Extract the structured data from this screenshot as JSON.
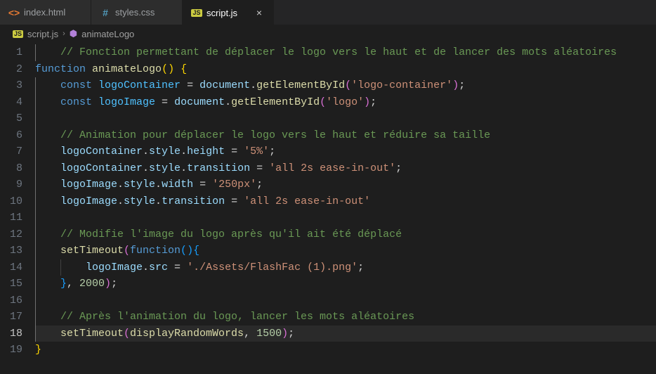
{
  "tabs": [
    {
      "label": "index.html",
      "iconClass": "icon-html",
      "iconText": "<>",
      "active": false
    },
    {
      "label": "styles.css",
      "iconClass": "icon-css",
      "iconText": "#",
      "active": false
    },
    {
      "label": "script.js",
      "iconClass": "icon-js",
      "iconText": "JS",
      "active": true
    }
  ],
  "breadcrumb": {
    "file": "script.js",
    "symbol": "animateLogo",
    "fileIconText": "JS",
    "symbolIconText": "⬢"
  },
  "code": {
    "lineCount": 19,
    "currentLine": 18,
    "lines": {
      "1": {
        "indent": 1,
        "tokens": [
          {
            "text": "// Fonction permettant de déplacer le logo vers le haut et de lancer des mots aléatoires",
            "cls": "c-comment"
          }
        ]
      },
      "2": {
        "indent": 0,
        "tokens": [
          {
            "text": "function",
            "cls": "c-keyword"
          },
          {
            "text": " ",
            "cls": ""
          },
          {
            "text": "animateLogo",
            "cls": "c-func"
          },
          {
            "text": "(",
            "cls": "c-brace-y"
          },
          {
            "text": ")",
            "cls": "c-brace-y"
          },
          {
            "text": " ",
            "cls": ""
          },
          {
            "text": "{",
            "cls": "c-brace-y"
          }
        ]
      },
      "3": {
        "indent": 1,
        "tokens": [
          {
            "text": "const",
            "cls": "c-keyword"
          },
          {
            "text": " ",
            "cls": ""
          },
          {
            "text": "logoContainer",
            "cls": "c-const"
          },
          {
            "text": " = ",
            "cls": "c-punct"
          },
          {
            "text": "document",
            "cls": "c-var"
          },
          {
            "text": ".",
            "cls": "c-punct"
          },
          {
            "text": "getElementById",
            "cls": "c-func"
          },
          {
            "text": "(",
            "cls": "c-brace-p"
          },
          {
            "text": "'logo-container'",
            "cls": "c-string"
          },
          {
            "text": ")",
            "cls": "c-brace-p"
          },
          {
            "text": ";",
            "cls": "c-punct"
          }
        ]
      },
      "4": {
        "indent": 1,
        "tokens": [
          {
            "text": "const",
            "cls": "c-keyword"
          },
          {
            "text": " ",
            "cls": ""
          },
          {
            "text": "logoImage",
            "cls": "c-const"
          },
          {
            "text": " = ",
            "cls": "c-punct"
          },
          {
            "text": "document",
            "cls": "c-var"
          },
          {
            "text": ".",
            "cls": "c-punct"
          },
          {
            "text": "getElementById",
            "cls": "c-func"
          },
          {
            "text": "(",
            "cls": "c-brace-p"
          },
          {
            "text": "'logo'",
            "cls": "c-string"
          },
          {
            "text": ")",
            "cls": "c-brace-p"
          },
          {
            "text": ";",
            "cls": "c-punct"
          }
        ]
      },
      "5": {
        "indent": 1,
        "tokens": []
      },
      "6": {
        "indent": 1,
        "tokens": [
          {
            "text": "// Animation pour déplacer le logo vers le haut et réduire sa taille",
            "cls": "c-comment"
          }
        ]
      },
      "7": {
        "indent": 1,
        "tokens": [
          {
            "text": "logoContainer",
            "cls": "c-var"
          },
          {
            "text": ".",
            "cls": "c-punct"
          },
          {
            "text": "style",
            "cls": "c-var"
          },
          {
            "text": ".",
            "cls": "c-punct"
          },
          {
            "text": "height",
            "cls": "c-var"
          },
          {
            "text": " = ",
            "cls": "c-punct"
          },
          {
            "text": "'5%'",
            "cls": "c-string"
          },
          {
            "text": ";",
            "cls": "c-punct"
          }
        ]
      },
      "8": {
        "indent": 1,
        "tokens": [
          {
            "text": "logoContainer",
            "cls": "c-var"
          },
          {
            "text": ".",
            "cls": "c-punct"
          },
          {
            "text": "style",
            "cls": "c-var"
          },
          {
            "text": ".",
            "cls": "c-punct"
          },
          {
            "text": "transition",
            "cls": "c-var"
          },
          {
            "text": " = ",
            "cls": "c-punct"
          },
          {
            "text": "'all 2s ease-in-out'",
            "cls": "c-string"
          },
          {
            "text": ";",
            "cls": "c-punct"
          }
        ]
      },
      "9": {
        "indent": 1,
        "tokens": [
          {
            "text": "logoImage",
            "cls": "c-var"
          },
          {
            "text": ".",
            "cls": "c-punct"
          },
          {
            "text": "style",
            "cls": "c-var"
          },
          {
            "text": ".",
            "cls": "c-punct"
          },
          {
            "text": "width",
            "cls": "c-var"
          },
          {
            "text": " = ",
            "cls": "c-punct"
          },
          {
            "text": "'250px'",
            "cls": "c-string"
          },
          {
            "text": ";",
            "cls": "c-punct"
          }
        ]
      },
      "10": {
        "indent": 1,
        "tokens": [
          {
            "text": "logoImage",
            "cls": "c-var"
          },
          {
            "text": ".",
            "cls": "c-punct"
          },
          {
            "text": "style",
            "cls": "c-var"
          },
          {
            "text": ".",
            "cls": "c-punct"
          },
          {
            "text": "transition",
            "cls": "c-var"
          },
          {
            "text": " = ",
            "cls": "c-punct"
          },
          {
            "text": "'all 2s ease-in-out'",
            "cls": "c-string"
          }
        ]
      },
      "11": {
        "indent": 1,
        "tokens": []
      },
      "12": {
        "indent": 1,
        "tokens": [
          {
            "text": "// Modifie l'image du logo après qu'il ait été déplacé",
            "cls": "c-comment"
          }
        ]
      },
      "13": {
        "indent": 1,
        "tokens": [
          {
            "text": "setTimeout",
            "cls": "c-func"
          },
          {
            "text": "(",
            "cls": "c-brace-p"
          },
          {
            "text": "function",
            "cls": "c-keyword"
          },
          {
            "text": "(",
            "cls": "c-brace-b"
          },
          {
            "text": ")",
            "cls": "c-brace-b"
          },
          {
            "text": "{",
            "cls": "c-brace-b"
          }
        ]
      },
      "14": {
        "indent": 2,
        "tokens": [
          {
            "text": "logoImage",
            "cls": "c-var"
          },
          {
            "text": ".",
            "cls": "c-punct"
          },
          {
            "text": "src",
            "cls": "c-var"
          },
          {
            "text": " = ",
            "cls": "c-punct"
          },
          {
            "text": "'./Assets/FlashFac (1).png'",
            "cls": "c-string"
          },
          {
            "text": ";",
            "cls": "c-punct"
          }
        ]
      },
      "15": {
        "indent": 1,
        "tokens": [
          {
            "text": "}",
            "cls": "c-brace-b"
          },
          {
            "text": ", ",
            "cls": "c-punct"
          },
          {
            "text": "2000",
            "cls": "c-number"
          },
          {
            "text": ")",
            "cls": "c-brace-p"
          },
          {
            "text": ";",
            "cls": "c-punct"
          }
        ]
      },
      "16": {
        "indent": 1,
        "tokens": []
      },
      "17": {
        "indent": 1,
        "tokens": [
          {
            "text": "// Après l'animation du logo, lancer les mots aléatoires",
            "cls": "c-comment"
          }
        ]
      },
      "18": {
        "indent": 1,
        "highlight": true,
        "tokens": [
          {
            "text": "setTimeout",
            "cls": "c-func"
          },
          {
            "text": "(",
            "cls": "c-brace-p"
          },
          {
            "text": "displayRandomWords",
            "cls": "c-func"
          },
          {
            "text": ", ",
            "cls": "c-punct"
          },
          {
            "text": "1500",
            "cls": "c-number"
          },
          {
            "text": ")",
            "cls": "c-brace-p"
          },
          {
            "text": ";",
            "cls": "c-punct"
          }
        ]
      },
      "19": {
        "indent": 0,
        "tokens": [
          {
            "text": "}",
            "cls": "c-brace-y"
          }
        ]
      }
    }
  }
}
